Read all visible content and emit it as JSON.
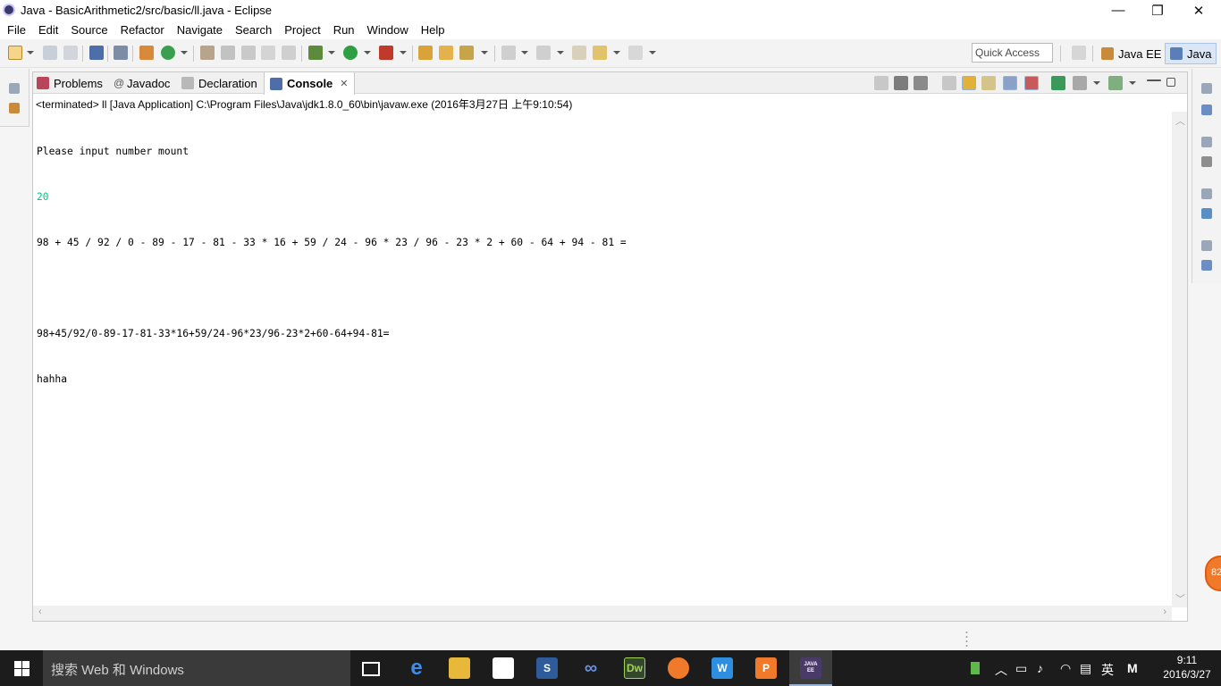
{
  "window": {
    "title": "Java - BasicArithmetic2/src/basic/ll.java - Eclipse",
    "minimize_glyph": "—",
    "restore_glyph": "❐",
    "close_glyph": "✕"
  },
  "menu": [
    "File",
    "Edit",
    "Source",
    "Refactor",
    "Navigate",
    "Search",
    "Project",
    "Run",
    "Window",
    "Help"
  ],
  "toolbar": {
    "quick_access_placeholder": "Quick Access",
    "perspectives": [
      {
        "label": "Java EE",
        "active": false
      },
      {
        "label": "Java",
        "active": true
      }
    ]
  },
  "tabs": [
    {
      "label": "Problems",
      "icon": "problems-icon",
      "active": false
    },
    {
      "label": "Javadoc",
      "icon": "at-icon",
      "active": false
    },
    {
      "label": "Declaration",
      "icon": "declaration-icon",
      "active": false
    },
    {
      "label": "Console",
      "icon": "console-icon",
      "active": true,
      "close_glyph": "✕"
    }
  ],
  "console": {
    "status": "<terminated> ll [Java Application] C:\\Program Files\\Java\\jdk1.8.0_60\\bin\\javaw.exe (2016年3月27日 上午9:10:54)",
    "lines": [
      {
        "text": "Please input number mount",
        "color": "#000000"
      },
      {
        "text": "20",
        "color": "#00c87d"
      },
      {
        "text": "98 + 45 / 92 / 0 - 89 - 17 - 81 - 33 * 16 + 59 / 24 - 96 * 23 / 96 - 23 * 2 + 60 - 64 + 94 - 81 =",
        "color": "#000000"
      },
      {
        "text": "",
        "color": "#000000"
      },
      {
        "text": "98+45/92/0-89-17-81-33*16+59/24-96*23/96-23*2+60-64+94-81=",
        "color": "#000000"
      },
      {
        "text": "hahha",
        "color": "#000000"
      }
    ]
  },
  "taskbar": {
    "search_placeholder": "搜索 Web 和 Windows",
    "apps": [
      {
        "name": "task-view-icon",
        "label": ""
      },
      {
        "name": "edge-icon",
        "label": "e"
      },
      {
        "name": "file-explorer-icon",
        "label": ""
      },
      {
        "name": "store-icon",
        "label": ""
      },
      {
        "name": "s-app-icon",
        "label": "S"
      },
      {
        "name": "infinity-app-icon",
        "label": "∞"
      },
      {
        "name": "dreamweaver-icon",
        "label": "Dw"
      },
      {
        "name": "orange-app-icon",
        "label": ""
      },
      {
        "name": "wps-writer-icon",
        "label": "W"
      },
      {
        "name": "wps-presentation-icon",
        "label": "P"
      },
      {
        "name": "eclipse-taskbar-icon",
        "label": "JAVA EE"
      }
    ],
    "ime_label": "英",
    "ime_mode": "M",
    "clock_time": "9:11",
    "clock_date": "2016/3/27"
  },
  "badge_text": "82",
  "colors": {
    "taskbar": "#1c1c1c",
    "console_input": "#00c87d",
    "accent": "#3a6ea5"
  }
}
